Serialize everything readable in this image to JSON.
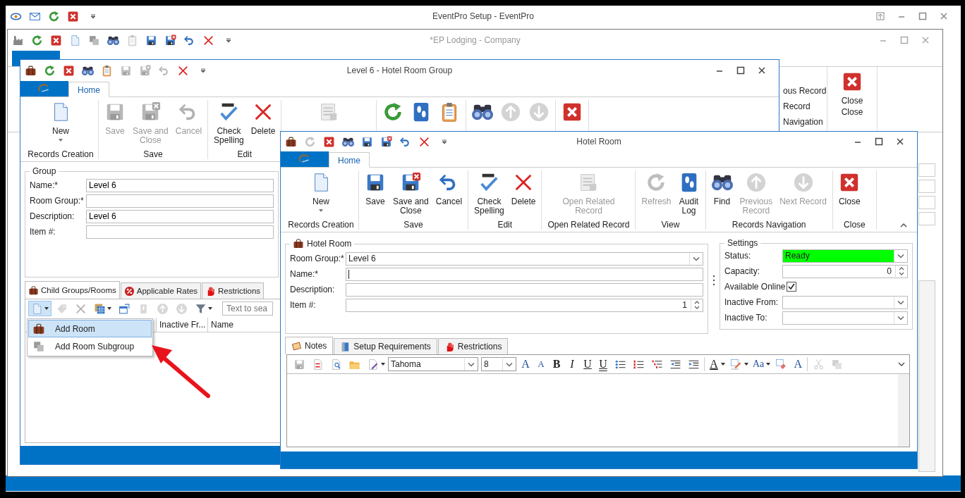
{
  "app": {
    "title": "EventPro Setup - EventPro",
    "quick_access": [
      {
        "kind": "eye",
        "disabled": false
      },
      {
        "kind": "mail",
        "disabled": false
      },
      {
        "kind": "refresh",
        "disabled": false
      },
      {
        "kind": "close",
        "disabled": false
      }
    ]
  },
  "company_window": {
    "title": "*EP Lodging - Company",
    "quick_access": [
      {
        "kind": "factory",
        "disabled": false
      },
      {
        "kind": "refresh",
        "disabled": false
      },
      {
        "kind": "close",
        "disabled": false
      },
      {
        "kind": "new",
        "disabled": false
      },
      {
        "kind": "copy",
        "disabled": false
      },
      {
        "kind": "find",
        "disabled": false
      },
      {
        "kind": "reports",
        "disabled": true
      },
      {
        "kind": "save",
        "disabled": false
      },
      {
        "kind": "saveclose",
        "disabled": false
      },
      {
        "kind": "cancel",
        "disabled": false
      },
      {
        "kind": "delete",
        "disabled": false
      }
    ],
    "nav_fragments": [
      "ous Record",
      "Record",
      "Navigation"
    ],
    "close_button": "Close",
    "close_group": "Close"
  },
  "group_window": {
    "title": "Level 6 - Hotel Room Group",
    "tab": "Home",
    "quick_access": [
      {
        "kind": "luggage",
        "disabled": false
      },
      {
        "kind": "refresh",
        "disabled": false
      },
      {
        "kind": "close",
        "disabled": false
      },
      {
        "kind": "find",
        "disabled": false
      },
      {
        "kind": "reports",
        "disabled": false
      },
      {
        "kind": "save",
        "disabled": true
      },
      {
        "kind": "saveclose",
        "disabled": true
      },
      {
        "kind": "cancel",
        "disabled": true
      },
      {
        "kind": "delete",
        "disabled": false
      }
    ],
    "ribbon": [
      {
        "label": "Records Creation",
        "buttons": [
          {
            "kind": "new",
            "label": "New",
            "disabled": false
          }
        ]
      },
      {
        "label": "Save",
        "buttons": [
          {
            "kind": "save",
            "label": "Save",
            "disabled": true
          },
          {
            "kind": "saveclose",
            "label": "Save and\nClose",
            "disabled": true
          },
          {
            "kind": "cancel",
            "label": "Cancel",
            "disabled": true
          }
        ]
      },
      {
        "label": "Edit",
        "buttons": [
          {
            "kind": "spell",
            "label": "Check\nSpelling",
            "disabled": false
          },
          {
            "kind": "delete",
            "label": "Delete",
            "disabled": false
          }
        ]
      },
      {
        "buttons": [
          {
            "kind": "related",
            "disabled": true
          }
        ]
      },
      {
        "buttons": [
          {
            "kind": "refresh",
            "disabled": false
          },
          {
            "kind": "audit",
            "disabled": false
          },
          {
            "kind": "reports",
            "disabled": false
          }
        ]
      },
      {
        "buttons": [
          {
            "kind": "find",
            "disabled": false
          },
          {
            "kind": "prev",
            "disabled": true
          },
          {
            "kind": "next",
            "disabled": true
          }
        ]
      },
      {
        "buttons": [
          {
            "kind": "close",
            "disabled": false
          }
        ]
      }
    ],
    "group_box": {
      "title": "Group",
      "fields": [
        {
          "label": "Name:*",
          "value": "Level 6"
        },
        {
          "label": "Room Group:*"
        },
        {
          "label": "Description:",
          "value": "Level 6"
        },
        {
          "label": "Item #:"
        }
      ]
    },
    "tabs": [
      {
        "label": "Child Groups/Rooms",
        "kind": "luggage",
        "selected": true
      },
      {
        "label": "Applicable Rates",
        "kind": "percent",
        "selected": false
      },
      {
        "label": "Restrictions",
        "kind": "hand",
        "selected": false
      }
    ],
    "toolbar": [
      {
        "kind": "new",
        "dropdown": true,
        "expanded": true,
        "disabled": false
      },
      {
        "kind": "tag",
        "dropdown": false,
        "expanded": false,
        "disabled": true
      },
      {
        "kind": "delete",
        "dropdown": false,
        "expanded": false,
        "disabled": true
      },
      {
        "kind": "grid",
        "dropdown": true,
        "expanded": false,
        "disabled": false
      },
      {
        "kind": "window",
        "dropdown": false,
        "expanded": false,
        "disabled": false
      },
      {
        "kind": "block",
        "dropdown": false,
        "expanded": false,
        "disabled": true
      },
      {
        "kind": "prev",
        "dropdown": false,
        "expanded": false,
        "disabled": true
      },
      {
        "kind": "next",
        "dropdown": false,
        "expanded": false,
        "disabled": true
      },
      {
        "kind": "filter",
        "dropdown": true,
        "expanded": false,
        "disabled": false
      }
    ],
    "search": {
      "placeholder": "Text to sea"
    },
    "columns": [
      "Inactive Fr...",
      "Name"
    ],
    "menu": [
      {
        "label": "Add Room",
        "selected": true
      },
      {
        "label": "Add Room Subgroup",
        "selected": false
      }
    ]
  },
  "room_window": {
    "title": "Hotel Room",
    "tab": "Home",
    "quick_access": [
      {
        "kind": "luggage",
        "disabled": false
      },
      {
        "kind": "refresh",
        "disabled": true
      },
      {
        "kind": "close",
        "disabled": false
      },
      {
        "kind": "find",
        "disabled": false
      },
      {
        "kind": "save",
        "disabled": false
      },
      {
        "kind": "saveclose",
        "disabled": false
      },
      {
        "kind": "cancel",
        "disabled": false
      },
      {
        "kind": "delete",
        "disabled": false
      }
    ],
    "ribbon": [
      {
        "label": "Records Creation",
        "buttons": [
          {
            "kind": "new",
            "label": "New",
            "disabled": false
          }
        ]
      },
      {
        "label": "Save",
        "buttons": [
          {
            "kind": "save",
            "label": "Save",
            "disabled": false
          },
          {
            "kind": "saveclose",
            "label": "Save and\nClose",
            "disabled": false
          },
          {
            "kind": "cancel",
            "label": "Cancel",
            "disabled": false
          }
        ]
      },
      {
        "label": "Edit",
        "buttons": [
          {
            "kind": "spell",
            "label": "Check\nSpelling",
            "disabled": false
          },
          {
            "kind": "delete",
            "label": "Delete",
            "disabled": false
          }
        ]
      },
      {
        "label": "Open Related Record",
        "buttons": [
          {
            "kind": "related",
            "label": "Open Related\nRecord",
            "disabled": true
          }
        ]
      },
      {
        "label": "View",
        "buttons": [
          {
            "kind": "refresh",
            "label": "Refresh",
            "disabled": true
          },
          {
            "kind": "audit",
            "label": "Audit\nLog",
            "disabled": false
          }
        ]
      },
      {
        "label": "Records Navigation",
        "buttons": [
          {
            "kind": "find",
            "label": "Find",
            "disabled": false
          },
          {
            "kind": "prev",
            "label": "Previous\nRecord",
            "disabled": true
          },
          {
            "kind": "next",
            "label": "Next Record",
            "disabled": true
          }
        ]
      },
      {
        "label": "Close",
        "buttons": [
          {
            "kind": "close",
            "label": "Close",
            "disabled": false
          }
        ]
      }
    ],
    "room_box": {
      "title": "Hotel Room",
      "fields": [
        {
          "label": "Room Group:*",
          "kind": "combo",
          "value": "Level 6"
        },
        {
          "label": "Name:*",
          "kind": "text"
        },
        {
          "label": "Description:",
          "kind": "text"
        },
        {
          "label": "Item #:",
          "kind": "spin",
          "value": "1"
        }
      ]
    },
    "settings": {
      "title": "Settings",
      "fields": [
        {
          "label": "Status:",
          "kind": "status",
          "value": "Ready"
        },
        {
          "label": "Capacity:",
          "kind": "spin",
          "value": "0"
        },
        {
          "label": "Available Online",
          "kind": "check",
          "checked": true
        },
        {
          "label": "Inactive From:",
          "kind": "combo"
        },
        {
          "label": "Inactive To:",
          "kind": "combo"
        }
      ]
    },
    "tabs": [
      {
        "label": "Notes",
        "kind": "notes",
        "selected": true
      },
      {
        "label": "Setup Requirements",
        "kind": "setup",
        "selected": false
      },
      {
        "label": "Restrictions",
        "kind": "hand",
        "selected": false
      }
    ],
    "editor_toolbar": [
      {
        "kind": "save",
        "disabled": true
      },
      {
        "kind": "pdf",
        "disabled": false
      },
      {
        "kind": "preview",
        "disabled": false
      },
      {
        "kind": "open",
        "disabled": false
      },
      {
        "kind": "style",
        "disabled": false
      },
      {
        "kind": "font",
        "value": "Tahoma"
      },
      {
        "kind": "size",
        "value": "8"
      },
      {
        "kind": "grow",
        "text": "A"
      },
      {
        "kind": "shrink",
        "text": "A"
      },
      {
        "kind": "bold",
        "text": "B"
      },
      {
        "kind": "italic",
        "text": "I"
      },
      {
        "kind": "underline",
        "text": "U"
      },
      {
        "kind": "dunderline",
        "text": "U"
      },
      {
        "kind": "bullets",
        "disabled": false
      },
      {
        "kind": "numbering",
        "disabled": false
      },
      {
        "kind": "multilevel",
        "disabled": false
      },
      {
        "kind": "outdent",
        "disabled": false
      },
      {
        "kind": "indent",
        "disabled": false
      },
      {
        "kind": "fontcolor",
        "text": "A"
      },
      {
        "kind": "highlight",
        "disabled": false
      },
      {
        "kind": "case",
        "text": "Aa"
      },
      {
        "kind": "clearformat",
        "disabled": false
      },
      {
        "kind": "fontdialog",
        "text": "A"
      },
      {
        "kind": "cut",
        "disabled": true
      },
      {
        "kind": "copy",
        "disabled": true
      }
    ]
  }
}
